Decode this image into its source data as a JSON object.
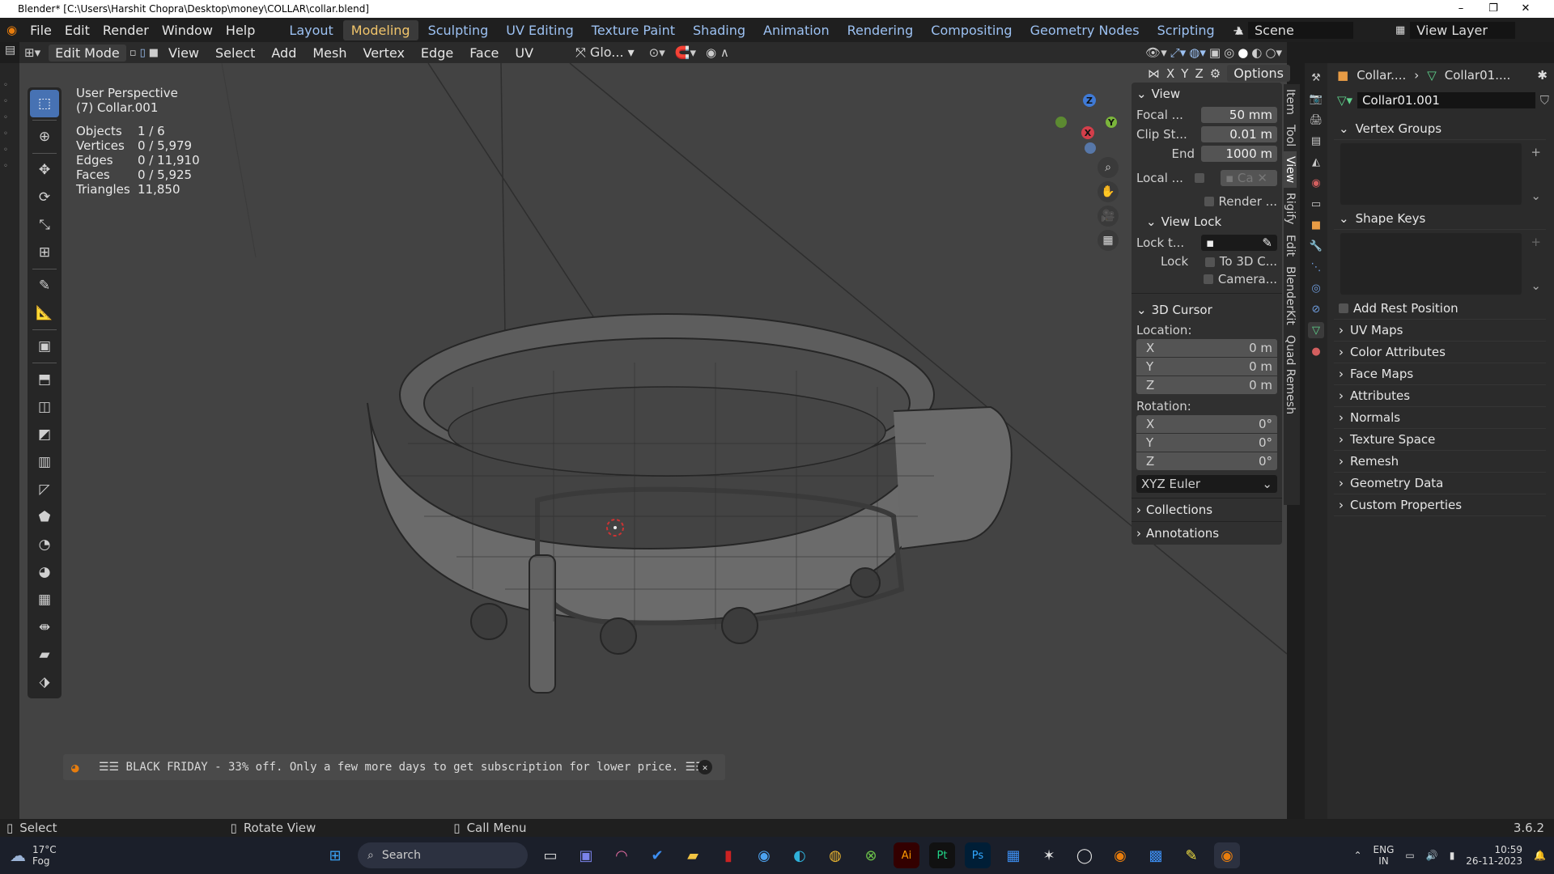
{
  "window": {
    "title": "Blender* [C:\\Users\\Harshit Chopra\\Desktop\\money\\COLLAR\\collar.blend]",
    "minimize": "–",
    "maximize": "❐",
    "close": "✕"
  },
  "menu": [
    "File",
    "Edit",
    "Render",
    "Window",
    "Help"
  ],
  "workspaces": [
    {
      "label": "Layout",
      "active": false
    },
    {
      "label": "Modeling",
      "active": true
    },
    {
      "label": "Sculpting",
      "active": false
    },
    {
      "label": "UV Editing",
      "active": false
    },
    {
      "label": "Texture Paint",
      "active": false
    },
    {
      "label": "Shading",
      "active": false
    },
    {
      "label": "Animation",
      "active": false
    },
    {
      "label": "Rendering",
      "active": false
    },
    {
      "label": "Compositing",
      "active": false
    },
    {
      "label": "Geometry Nodes",
      "active": false
    },
    {
      "label": "Scripting",
      "active": false
    }
  ],
  "add_workspace": "+",
  "scene": "Scene",
  "view_layer": "View Layer",
  "header": {
    "mode": "Edit Mode",
    "menus": [
      "View",
      "Select",
      "Add",
      "Mesh",
      "Vertex",
      "Edge",
      "Face",
      "UV"
    ],
    "transform": "Glo...",
    "options": "Options",
    "axes": [
      "X",
      "Y",
      "Z"
    ]
  },
  "viewport": {
    "perspective": "User Perspective",
    "object": "(7) Collar.001",
    "stats": [
      {
        "label": "Objects",
        "value": "1 / 6"
      },
      {
        "label": "Vertices",
        "value": "0 / 5,979"
      },
      {
        "label": "Edges",
        "value": "0 / 11,910"
      },
      {
        "label": "Faces",
        "value": "0 / 5,925"
      },
      {
        "label": "Triangles",
        "value": "11,850"
      }
    ],
    "gizmo": {
      "z": "Z",
      "y": "Y",
      "x": "X"
    }
  },
  "npanel": {
    "view_title": "View",
    "focal_label": "Focal ...",
    "focal": "50 mm",
    "clip_start_label": "Clip St...",
    "clip_start": "0.01 m",
    "end_label": "End",
    "end": "1000 m",
    "local_label": "Local ...",
    "local_value": "Ca",
    "render_label": "Render ...",
    "viewlock_title": "View Lock",
    "lock_to_label": "Lock t...",
    "lock_label": "Lock",
    "to3d": "To 3D C...",
    "camera": "Camera...",
    "cursor_title": "3D Cursor",
    "location_label": "Location:",
    "loc": [
      {
        "axis": "X",
        "value": "0 m"
      },
      {
        "axis": "Y",
        "value": "0 m"
      },
      {
        "axis": "Z",
        "value": "0 m"
      }
    ],
    "rotation_label": "Rotation:",
    "rot": [
      {
        "axis": "X",
        "value": "0°"
      },
      {
        "axis": "Y",
        "value": "0°"
      },
      {
        "axis": "Z",
        "value": "0°"
      }
    ],
    "rot_mode": "XYZ Euler",
    "collections": "Collections",
    "annotations": "Annotations"
  },
  "ntabs": [
    "Item",
    "Tool",
    "View",
    "Rigify",
    "Edit",
    "BlenderKit",
    "Quad Remesh"
  ],
  "properties": {
    "breadcrumb_obj": "Collar....",
    "breadcrumb_mesh": "Collar01....",
    "mesh_name": "Collar01.001",
    "vertex_groups": "Vertex Groups",
    "shape_keys": "Shape Keys",
    "add_rest": "Add Rest Position",
    "sections": [
      "UV Maps",
      "Color Attributes",
      "Face Maps",
      "Attributes",
      "Normals",
      "Texture Space",
      "Remesh",
      "Geometry Data",
      "Custom Properties"
    ]
  },
  "notification": "☰☰ BLACK FRIDAY - 33% off. Only a few more days to get subscription for lower price. ☰☰",
  "status": {
    "select": "Select",
    "rotate": "Rotate View",
    "call_menu": "Call Menu",
    "version": "3.6.2"
  },
  "taskbar": {
    "weather_temp": "17°C",
    "weather_desc": "Fog",
    "search": "Search",
    "lang": "ENG",
    "region": "IN",
    "time": "10:59",
    "date": "26-11-2023"
  }
}
